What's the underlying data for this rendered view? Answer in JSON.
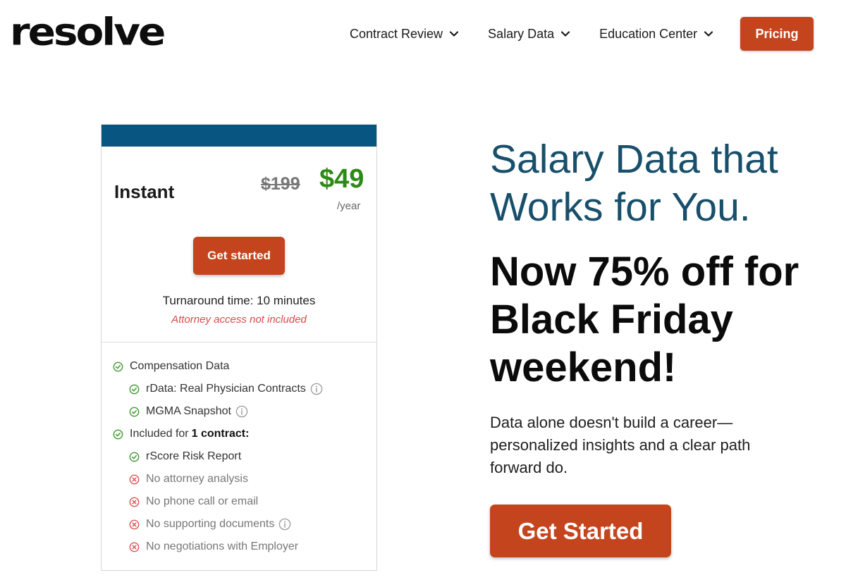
{
  "brand": {
    "logo_text": "resolve"
  },
  "nav": {
    "items": [
      {
        "label": "Contract Review"
      },
      {
        "label": "Salary Data"
      },
      {
        "label": "Education Center"
      }
    ],
    "pricing_label": "Pricing"
  },
  "card": {
    "plan_name": "Instant",
    "old_price": "$199",
    "new_price": "$49",
    "period": "/year",
    "button_label": "Get started",
    "turnaround": "Turnaround time: 10 minutes",
    "attorney_note": "Attorney access not included",
    "features": [
      {
        "text": "Compensation Data",
        "status": "included",
        "info": false
      },
      {
        "text": "rData: Real Physician Contracts",
        "status": "included",
        "info": true
      },
      {
        "text": "MGMA Snapshot",
        "status": "included",
        "info": true
      },
      {
        "text": "Included for",
        "bold": "1 contract:",
        "status": "included",
        "info": false
      },
      {
        "text": "rScore Risk Report",
        "status": "included",
        "info": false
      },
      {
        "text": "No attorney analysis",
        "status": "excluded",
        "info": false
      },
      {
        "text": "No phone call or email",
        "status": "excluded",
        "info": false
      },
      {
        "text": "No supporting documents",
        "status": "excluded",
        "info": true
      },
      {
        "text": "No negotiations with Employer",
        "status": "excluded",
        "info": false
      }
    ]
  },
  "hero": {
    "headline_line1": "Salary Data that",
    "headline_line2": "Works for You.",
    "promo_line1": "Now 75% off for",
    "promo_line2": "Black Friday",
    "promo_line3": "weekend!",
    "desc_line1": "Data alone doesn't build a career—",
    "desc_line2": "personalized insights and a clear path",
    "desc_line3": "forward do.",
    "cta_label": "Get Started"
  },
  "colors": {
    "accent": "#c4451d",
    "card_bar": "#075580",
    "price_green": "#2f8a15",
    "headline_blue": "#184f6b",
    "check_green": "#3e9a2e",
    "cross_red": "#d95555"
  },
  "icons": {
    "nav_chevron": "chevron-down-icon",
    "included": "check-circle-icon",
    "excluded": "x-circle-icon",
    "info": "info-icon"
  }
}
